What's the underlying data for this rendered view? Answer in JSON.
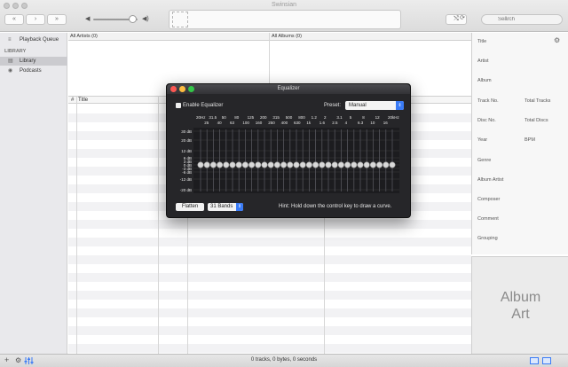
{
  "window": {
    "title": "Swinsian"
  },
  "toolbar": {
    "prev_icon": "rewind-icon",
    "play_icon": "play-icon",
    "next_icon": "fast-forward-icon",
    "prev_label": "«",
    "play_label": "›",
    "next_label": "»",
    "volume_low_glyph": "◀",
    "volume_high_glyph": "◀)",
    "volume_level": 0.88,
    "shuffle_glyph": "⤭",
    "repeat_glyph": "⟳",
    "search_placeholder": "Search"
  },
  "sidebar": {
    "items_top": [
      {
        "label": "Playback Queue",
        "icon": "list-icon",
        "glyph": "≡"
      }
    ],
    "section_label": "LIBRARY",
    "library_items": [
      {
        "label": "Library",
        "icon": "library-icon",
        "glyph": "▤",
        "selected": true
      },
      {
        "label": "Podcasts",
        "icon": "podcast-icon",
        "glyph": "◉",
        "selected": false
      }
    ],
    "add_glyph": "+",
    "gear_glyph": "⚙"
  },
  "browser": {
    "artists_header": "All Artists (0)",
    "albums_header": "All Albums (0)"
  },
  "track_list": {
    "columns": [
      "#",
      "Title"
    ]
  },
  "info_panel": {
    "gear_glyph": "⚙",
    "fields": [
      "Title",
      "Artist",
      "Album",
      "Track No.",
      "Total Tracks",
      "Disc No.",
      "Total Discs",
      "Year",
      "BPM",
      "Genre",
      "Album Artist",
      "Composer",
      "Comment",
      "Grouping"
    ],
    "album_art_label": "Album\nArt"
  },
  "status_bar": {
    "text": "0 tracks, 0 bytes, 0 seconds"
  },
  "equalizer": {
    "title": "Equalizer",
    "enable_label": "Enable Equalizer",
    "preset_label": "Preset:",
    "preset_value": "Manual",
    "freq_top": [
      "20Hz",
      "31.5",
      "50",
      "80",
      "125",
      "200",
      "315",
      "500",
      "800",
      "1.2",
      "2",
      "3.1",
      "5",
      "8",
      "12",
      "20kHz"
    ],
    "freq_bottom": [
      "25",
      "40",
      "63",
      "100",
      "160",
      "250",
      "400",
      "630",
      "1k",
      "1.6",
      "2.5",
      "4",
      "6.3",
      "10",
      "16"
    ],
    "db_labels": [
      "30 dB",
      "20 dB",
      "12 dB",
      "6 dB",
      "3 dB",
      "0 dB",
      "-3 dB",
      "-6 dB",
      "-12 dB",
      "-20 dB"
    ],
    "bands_gain_db": [
      0,
      0,
      0,
      0,
      0,
      0,
      0,
      0,
      0,
      0,
      0,
      0,
      0,
      0,
      0,
      0,
      0,
      0,
      0,
      0,
      0,
      0,
      0,
      0,
      0,
      0,
      0,
      0,
      0,
      0,
      0
    ],
    "flatten_label": "Flatten",
    "bands_label": "31 Bands",
    "hint": "Hint: Hold down the control key to draw a curve.",
    "colors": {
      "red": "#fc5753",
      "yellow": "#fdbc40",
      "green": "#33c748",
      "accent": "#3a7bf6"
    }
  }
}
